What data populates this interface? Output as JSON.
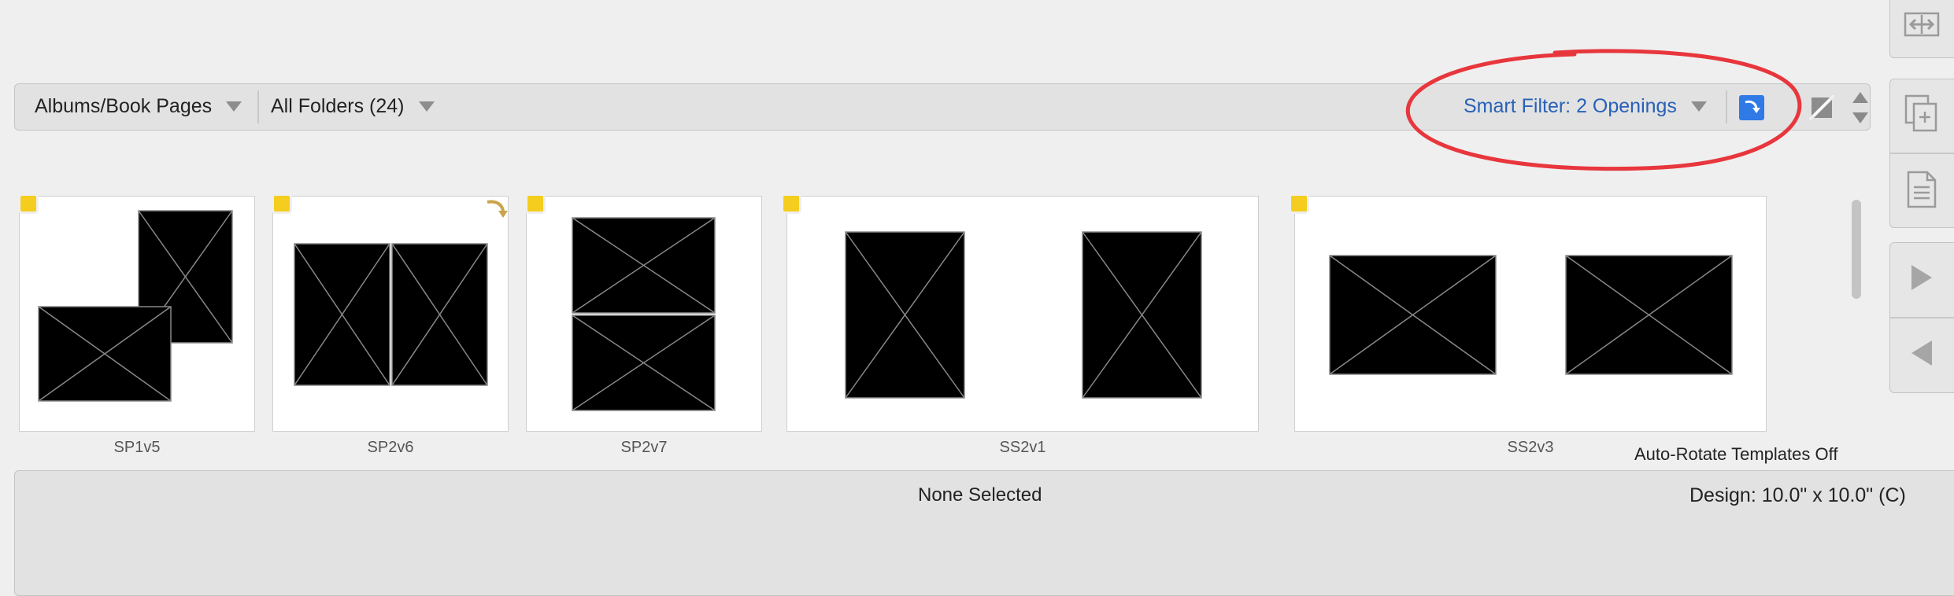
{
  "toolbar": {
    "albums_menu": "Albums/Book Pages",
    "folders_menu": "All Folders (24)",
    "smart_filter": "Smart Filter: 2 Openings"
  },
  "thumbnails": [
    {
      "label": "SP1v5"
    },
    {
      "label": "SP2v6"
    },
    {
      "label": "SP2v7"
    },
    {
      "label": "SS2v1"
    },
    {
      "label": "SS2v3"
    }
  ],
  "auto_rotate_label": "Auto-Rotate Templates Off",
  "info": {
    "selection": "None Selected",
    "design": "Design: 10.0\" x 10.0\" (C)"
  },
  "colors": {
    "flag": "#f5cd1e",
    "smart_filter_text": "#2861b8",
    "annotation": "#e8363d",
    "refresh_button": "#2f7ae6"
  },
  "icons": {
    "sidebar": [
      "resize-horizontal-icon",
      "add-page-icon",
      "document-icon",
      "play-right-icon",
      "play-left-icon"
    ]
  }
}
